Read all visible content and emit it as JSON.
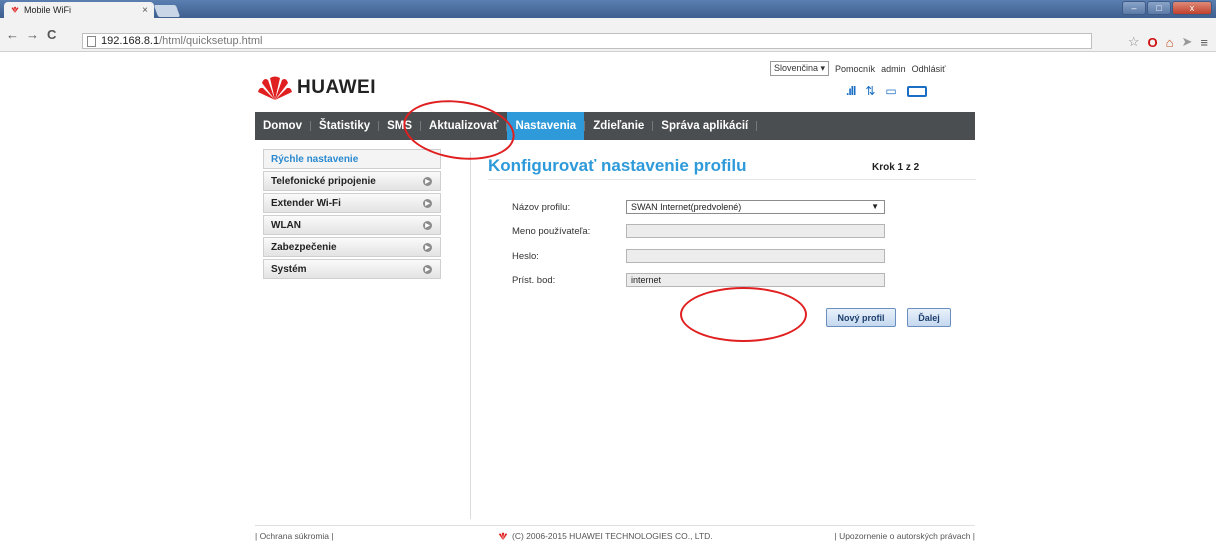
{
  "browser": {
    "tab_title": "Mobile WiFi",
    "tab_close": "×",
    "url_host": "192.168.8.1",
    "url_path": "/html/quicksetup.html",
    "back": "←",
    "forward": "→",
    "reload": "C",
    "window_controls": [
      "–",
      "□",
      "x"
    ]
  },
  "header": {
    "language": "Slovenčina ▾",
    "links": [
      "Pomocník",
      "admin",
      "Odhlásiť"
    ],
    "brand": "HUAWEI"
  },
  "menu": [
    "Domov",
    "Štatistiky",
    "SMS",
    "Aktualizovať",
    "Nastavenia",
    "Zdieľanie",
    "Správa aplikácií"
  ],
  "menu_active": "Nastavenia",
  "sidebar": [
    {
      "label": "Rýchle nastavenie",
      "active": true
    },
    {
      "label": "Telefonické pripojenie"
    },
    {
      "label": "Extender Wi-Fi"
    },
    {
      "label": "WLAN"
    },
    {
      "label": "Zabezpečenie"
    },
    {
      "label": "Systém"
    }
  ],
  "content": {
    "title": "Konfigurovať nastavenie profilu",
    "step": "Krok 1 z 2",
    "fields": {
      "profile_label": "Názov profilu:",
      "profile_value": "SWAN Internet(predvolené)",
      "username_label": "Meno používateľa:",
      "username_value": "",
      "password_label": "Heslo:",
      "password_value": "",
      "apn_label": "Príst. bod:",
      "apn_value": "internet"
    },
    "buttons": {
      "new_profile": "Nový profil",
      "next": "Ďalej"
    }
  },
  "footer": {
    "privacy": "| Ochrana súkromia |",
    "copyright": "(C) 2006-2015 HUAWEI TECHNOLOGIES CO., LTD.",
    "rights": "| Upozornenie o autorských právach |"
  },
  "colors": {
    "accent": "#2e9ad9",
    "menubar": "#4a4e50",
    "annotation": "#e02020",
    "brand_red": "#e02020"
  }
}
